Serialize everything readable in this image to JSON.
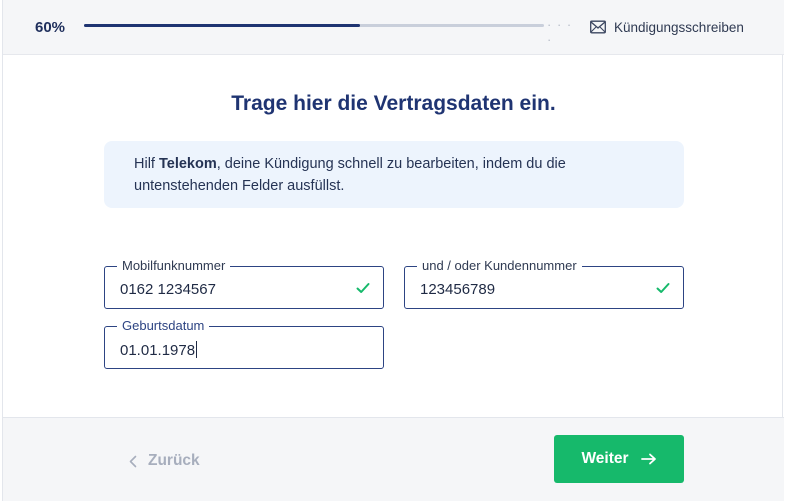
{
  "header": {
    "progress_text": "60%",
    "progress_value": 0.6,
    "step_label": "Kündigungsschreiben",
    "step_icon": "envelope-icon",
    "dots": "· · · ·"
  },
  "main": {
    "title": "Trage hier die Vertragsdaten ein.",
    "info": {
      "prefix": "Hilf ",
      "company": "Telekom",
      "suffix": ", deine Kündigung schnell zu bearbeiten, indem du die untenstehenden Felder ausfüllst."
    },
    "fields": {
      "mobile": {
        "label": "Mobilfunknummer",
        "value": "0162 1234567",
        "valid": true
      },
      "customer": {
        "label": "und / oder Kundennummer",
        "value": "123456789",
        "valid": true
      },
      "birthdate": {
        "label": "Geburtsdatum",
        "value": "01.01.1978",
        "focused": true
      }
    }
  },
  "footer": {
    "back_label": "Zurück",
    "next_label": "Weiter"
  },
  "colors": {
    "primary": "#1f3472",
    "accent_green": "#16b96b",
    "info_bg": "#edf4fd"
  }
}
